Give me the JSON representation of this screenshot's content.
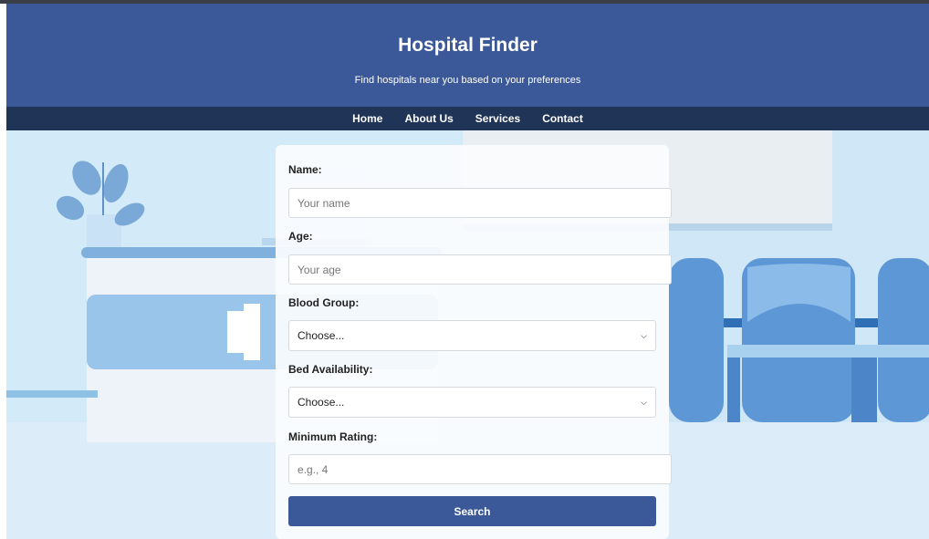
{
  "header": {
    "title": "Hospital Finder",
    "subtitle": "Find hospitals near you based on your preferences"
  },
  "nav": {
    "items": [
      "Home",
      "About Us",
      "Services",
      "Contact"
    ]
  },
  "form": {
    "name": {
      "label": "Name:",
      "placeholder": "Your name"
    },
    "age": {
      "label": "Age:",
      "placeholder": "Your age"
    },
    "blood_group": {
      "label": "Blood Group:",
      "selected": "Choose..."
    },
    "bed_availability": {
      "label": "Bed Availability:",
      "selected": "Choose..."
    },
    "minimum_rating": {
      "label": "Minimum Rating:",
      "placeholder": "e.g., 4"
    },
    "search_label": "Search"
  },
  "colors": {
    "header_bg": "#3b5998",
    "nav_bg": "#1f3457",
    "button_bg": "#3b5998",
    "scene_bg": "#d3ebf8"
  },
  "icons": [
    "chevron-down-icon"
  ]
}
